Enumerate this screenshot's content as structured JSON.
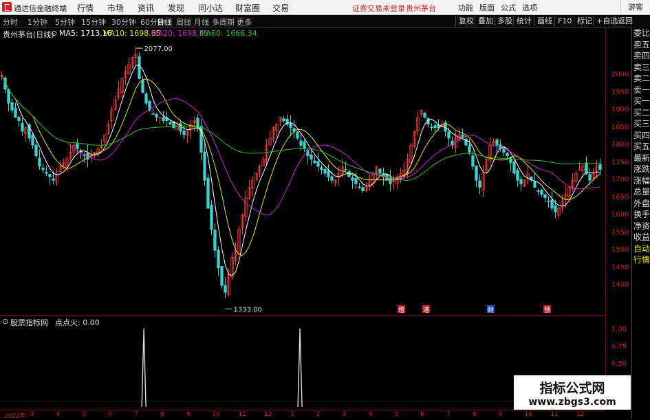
{
  "app": {
    "title": "通达信金融终端"
  },
  "menu": [
    "行情",
    "市场",
    "资讯",
    "发现",
    "问小达",
    "财富圈",
    "交易"
  ],
  "status": {
    "login": "证券交易未登录",
    "stock": "贵州茅台"
  },
  "rmenu": [
    "功能",
    "版面",
    "公式",
    "选项"
  ],
  "guest": "游客",
  "periods": [
    "分时",
    "1分钟",
    "5分钟",
    "15分钟",
    "30分钟",
    "60分钟",
    "日线",
    "周线",
    "月线",
    "多周期",
    "更多"
  ],
  "active_period": "日线",
  "tools": [
    "复权",
    "叠加",
    "多股",
    "统计",
    "画线",
    "F10",
    "标记",
    "+自选",
    "返回"
  ],
  "info": {
    "title": "贵州茅台(日线)",
    "ma5": "MA5: 1713.16",
    "ma10": "MA10: 1698.65",
    "ma20": "MA20: 1698.45",
    "ma60": "MA60: 1666.34"
  },
  "annotations": {
    "high": "2077.00",
    "low": "1333.00"
  },
  "events": [
    "增",
    "港",
    "财",
    "预"
  ],
  "indicator": {
    "name": "股票指标网",
    "value": "点点火: 0.00"
  },
  "right_panel": [
    "委比",
    "卖五",
    "卖四",
    "卖三",
    "卖二",
    "卖一",
    "买一",
    "买二",
    "买三",
    "买四",
    "买五",
    "最新",
    "涨跌",
    "涨幅",
    "总量",
    "外盘",
    "换手",
    "净资",
    "收益",
    "自动",
    "行情"
  ],
  "xaxis": [
    "2022年",
    "3",
    "4",
    "5",
    "6",
    "7",
    "8",
    "9",
    "10",
    "11",
    "12",
    "1",
    "2",
    "3",
    "4",
    "5",
    "6",
    "7",
    "8",
    "9",
    "10",
    "11",
    "12"
  ],
  "watermark": {
    "line1": "指标公式网",
    "line2": "www.zbgs3.com"
  },
  "chart_data": {
    "type": "candlestick",
    "title": "贵州茅台(日线)",
    "y_ticks": [
      2000,
      1950,
      1900,
      1850,
      1800,
      1750,
      1700,
      1650,
      1600,
      1550,
      1500,
      1450,
      1400
    ],
    "ylim": [
      1320,
      2085
    ],
    "close": [
      2000,
      1960,
      1920,
      1900,
      1880,
      1870,
      1840,
      1850,
      1820,
      1800,
      1770,
      1740,
      1730,
      1720,
      1710,
      1700,
      1720,
      1740,
      1750,
      1760,
      1780,
      1800,
      1790,
      1780,
      1770,
      1760,
      1770,
      1780,
      1790,
      1800,
      1830,
      1860,
      1900,
      1930,
      1960,
      1990,
      2010,
      2030,
      2050,
      2060,
      1990,
      1950,
      1920,
      1900,
      1890,
      1880,
      1880,
      1870,
      1870,
      1860,
      1850,
      1860,
      1840,
      1830,
      1840,
      1860,
      1870,
      1850,
      1780,
      1700,
      1620,
      1560,
      1500,
      1450,
      1400,
      1380,
      1430,
      1480,
      1500,
      1560,
      1600,
      1650,
      1680,
      1700,
      1720,
      1740,
      1760,
      1800,
      1820,
      1850,
      1860,
      1880,
      1870,
      1860,
      1850,
      1840,
      1820,
      1800,
      1790,
      1770,
      1760,
      1750,
      1740,
      1730,
      1720,
      1710,
      1700,
      1700,
      1720,
      1740,
      1730,
      1710,
      1700,
      1690,
      1680,
      1670,
      1680,
      1700,
      1720,
      1740,
      1720,
      1710,
      1700,
      1690,
      1700,
      1710,
      1720,
      1730,
      1760,
      1800,
      1840,
      1880,
      1900,
      1880,
      1860,
      1850,
      1850,
      1850,
      1860,
      1840,
      1820,
      1800,
      1820,
      1830,
      1820,
      1800,
      1780,
      1740,
      1700,
      1680,
      1720,
      1760,
      1800,
      1810,
      1800,
      1790,
      1780,
      1770,
      1750,
      1720,
      1700,
      1690,
      1700,
      1720,
      1700,
      1680,
      1670,
      1660,
      1650,
      1640,
      1620,
      1610,
      1620,
      1640,
      1660,
      1680,
      1700,
      1720,
      1730,
      1740,
      1720,
      1700,
      1720,
      1740,
      1730
    ],
    "series": [
      {
        "name": "MA5",
        "color": "#ffffff"
      },
      {
        "name": "MA10",
        "color": "#e6e600"
      },
      {
        "name": "MA20",
        "color": "#d020d0"
      },
      {
        "name": "MA60",
        "color": "#20c020"
      }
    ],
    "indicator": {
      "name": "点点火",
      "y_ticks": [
        1.0,
        0.75,
        0.5,
        0.25,
        0.0
      ],
      "spikes_at_month": [
        "7",
        "1"
      ]
    }
  }
}
